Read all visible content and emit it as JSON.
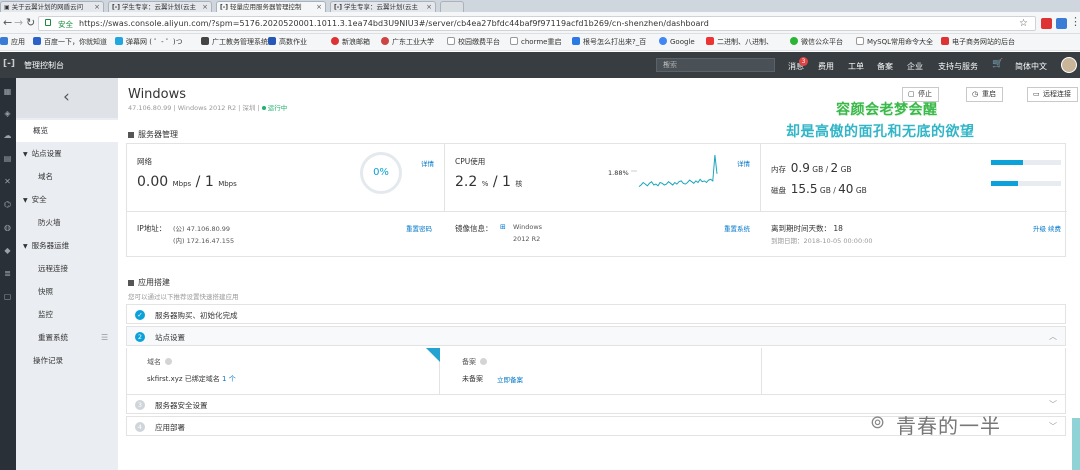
{
  "browser": {
    "tabs": [
      {
        "label": "关于云翼计划的网盾云问",
        "active": false
      },
      {
        "label": "学生专享：云翼计划(云主",
        "active": false
      },
      {
        "label": "轻量应用服务器管理控制",
        "active": true
      },
      {
        "label": "学生专享：云翼计划(云主",
        "active": false
      }
    ],
    "secure_label": "安全",
    "url": "https://swas.console.aliyun.com/?spm=5176.2020520001.1011.3.1ea74bd3U9NIU3#/server/cb4ea27bfdc44baf9f97119acfd1b269/cn-shenzhen/dashboard",
    "bookmarks": [
      "应用",
      "百度一下，你就知道",
      "弹幕网 ( ゜- ゜)つ",
      "广工教务管理系统",
      "高数作业",
      "新浪邮箱",
      "广东工业大学",
      "校园缴费平台",
      "chorme重启",
      "根号怎么打出来?_百",
      "Google",
      "二进制、八进制、",
      "微信公众平台",
      "MySQL常用命令大全",
      "电子商务网站的后台"
    ]
  },
  "header": {
    "title": "管理控制台",
    "search_placeholder": "搜索",
    "nav": [
      "消息",
      "费用",
      "工单",
      "备案",
      "企业",
      "支持与服务"
    ],
    "message_count": "3",
    "lang": "简体中文"
  },
  "sidebar": {
    "items": [
      {
        "label": "概览",
        "kind": "item",
        "active": true
      },
      {
        "label": "站点设置",
        "kind": "group"
      },
      {
        "label": "域名",
        "kind": "sub"
      },
      {
        "label": "安全",
        "kind": "group"
      },
      {
        "label": "防火墙",
        "kind": "sub"
      },
      {
        "label": "服务器运维",
        "kind": "group"
      },
      {
        "label": "远程连接",
        "kind": "sub"
      },
      {
        "label": "快照",
        "kind": "sub"
      },
      {
        "label": "监控",
        "kind": "sub"
      },
      {
        "label": "重置系统",
        "kind": "sub"
      },
      {
        "label": "操作记录",
        "kind": "item"
      }
    ]
  },
  "server": {
    "name": "Windows",
    "ip": "47.106.80.99",
    "os": "Windows 2012 R2",
    "region": "深圳",
    "status": "运行中",
    "actions": {
      "stop": "停止",
      "restart": "重启",
      "remote": "远程连接"
    }
  },
  "overlay": {
    "line1": "容颜会老梦会醒",
    "line2": "却是高傲的面孔和无底的欲望"
  },
  "server_mgmt": {
    "title": "服务器管理",
    "network": {
      "label": "网络",
      "value_down": "0.00",
      "unit_down": "Mbps",
      "value_up": "1",
      "unit_up": "Mbps",
      "percent": "0%",
      "percent_value": 0,
      "detail": "详情"
    },
    "cpu": {
      "label": "CPU使用",
      "usage": "2.2",
      "usage_unit": "%",
      "cores": "1",
      "cores_unit": "核",
      "current": "1.88%",
      "detail": "详情"
    },
    "memory": {
      "label": "内存",
      "used": "0.9",
      "used_unit": "GB",
      "total": "2",
      "total_unit": "GB",
      "fill": 0.45
    },
    "disk": {
      "label": "磁盘",
      "used": "15.5",
      "used_unit": "GB",
      "total": "40",
      "total_unit": "GB",
      "fill": 0.39
    },
    "ip_label": "IP地址：",
    "ip_public": "(公) 47.106.80.99",
    "ip_private": "(内) 172.16.47.155",
    "reset_password": "重置密码",
    "image_label": "镜像信息：",
    "image_line1": "Windows",
    "image_line2": "2012 R2",
    "reset_system": "重置系统",
    "expire_label": "离到期时间天数：",
    "expire_days": "18",
    "expire_date": "到期日期：2018-10-05 00:00:00",
    "upgrade": "升级",
    "renew": "续费"
  },
  "app_setup": {
    "title": "应用搭建",
    "subtitle": "您可以通过以下推荐设置快速搭建应用",
    "steps": [
      {
        "num": "✓",
        "label": "服务器购买、初始化完成"
      },
      {
        "num": "2",
        "label": "站点设置"
      },
      {
        "num": "3",
        "label": "服务器安全设置"
      },
      {
        "num": "4",
        "label": "应用部署"
      }
    ],
    "domain_label": "域名",
    "domain_value": "skfirst.xyz 已绑定域名",
    "domain_count": "1 个",
    "icp_label": "备案",
    "icp_value": "未备案",
    "icp_link": "立即备案"
  },
  "watermark": "青春的一半",
  "colors": {
    "accent": "#0ca1d8",
    "link": "#0077c8",
    "header": "#373d41",
    "success": "#1fb26d"
  },
  "chart_data": {
    "type": "line",
    "title": "",
    "series": [
      {
        "name": "",
        "values": [
          0.3,
          0.5,
          0.8,
          0.6,
          0.4,
          0.7,
          0.9,
          0.5,
          0.6,
          0.4,
          0.8,
          0.7,
          0.5,
          0.6,
          0.9,
          0.7,
          0.5,
          0.8,
          0.6,
          0.9,
          1.0,
          0.7,
          0.6,
          0.8,
          1.1,
          0.9,
          0.7,
          1.0,
          0.8,
          1.2,
          0.9,
          1.0,
          0.8,
          1.1,
          1.2,
          1.0,
          4.2,
          1.88
        ]
      }
    ],
    "annotation": "1.88%"
  }
}
